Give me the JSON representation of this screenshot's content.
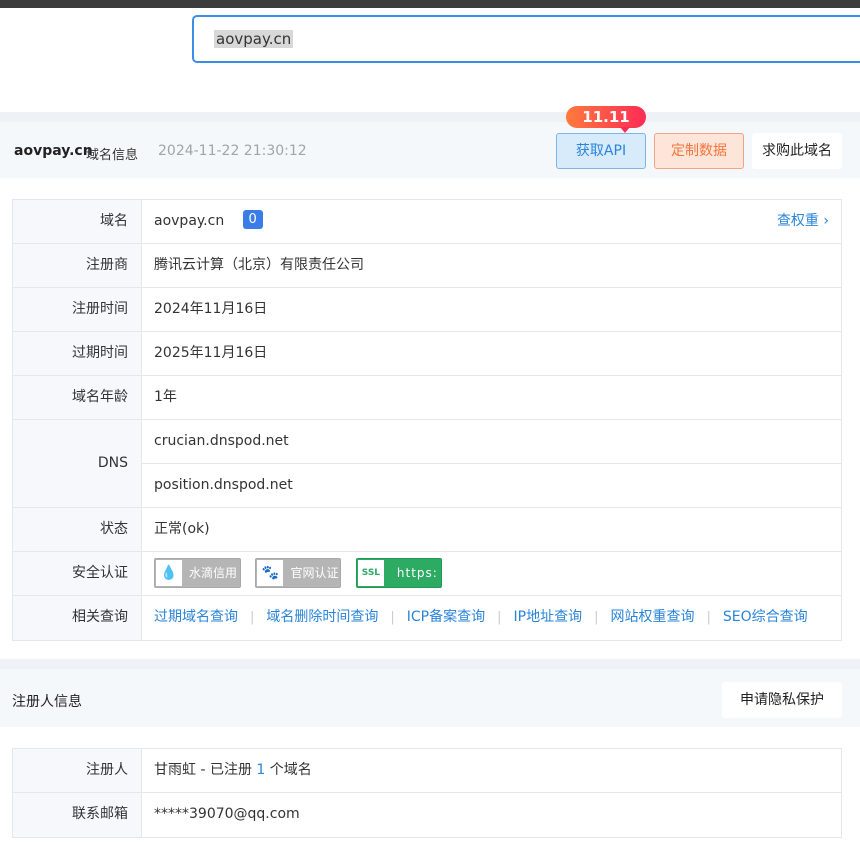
{
  "search": {
    "value": "aovpay.cn"
  },
  "info_header": {
    "domain": "aovpay.cn",
    "suffix": "域名信息",
    "timestamp": "2024-11-22 21:30:12",
    "promo_badge": "11.11",
    "api_button": "获取API",
    "custom_button": "定制数据",
    "buy_button": "求购此域名"
  },
  "domain_table": {
    "domain": {
      "label": "域名",
      "value": "aovpay.cn",
      "score": "0",
      "link": "查权重"
    },
    "registrar": {
      "label": "注册商",
      "value": "腾讯云计算（北京）有限责任公司"
    },
    "reg_date": {
      "label": "注册时间",
      "value": "2024年11月16日"
    },
    "exp_date": {
      "label": "过期时间",
      "value": "2025年11月16日"
    },
    "age": {
      "label": "域名年龄",
      "value": "1年"
    },
    "dns": {
      "label": "DNS",
      "values": [
        "crucian.dnspod.net",
        "position.dnspod.net"
      ]
    },
    "status": {
      "label": "状态",
      "value": "正常(ok)"
    },
    "security": {
      "label": "安全认证",
      "certs": [
        {
          "icon": "water-drop-icon",
          "text": "水滴信用"
        },
        {
          "icon": "baidu-paw-icon",
          "text": "官网认证"
        },
        {
          "icon": "ssl-shield-icon",
          "text": "https:"
        }
      ]
    },
    "related": {
      "label": "相关查询",
      "links": [
        "过期域名查询",
        "域名删除时间查询",
        "ICP备案查询",
        "IP地址查询",
        "网站权重查询",
        "SEO综合查询"
      ],
      "separator": "|"
    }
  },
  "registrant_header": {
    "title": "注册人信息",
    "privacy_button": "申请隐私保护"
  },
  "registrant_table": {
    "registrant": {
      "label": "注册人",
      "name": "甘雨虹",
      "mid": " - 已注册 ",
      "count": "1",
      "tail": " 个域名"
    },
    "email": {
      "label": "联系邮箱",
      "value": "*****39070@qq.com"
    }
  },
  "colors": {
    "accent": "#2a84d8",
    "promo": "#ff2b55",
    "custom": "#f0763d",
    "ssl_green": "#2eab63"
  }
}
